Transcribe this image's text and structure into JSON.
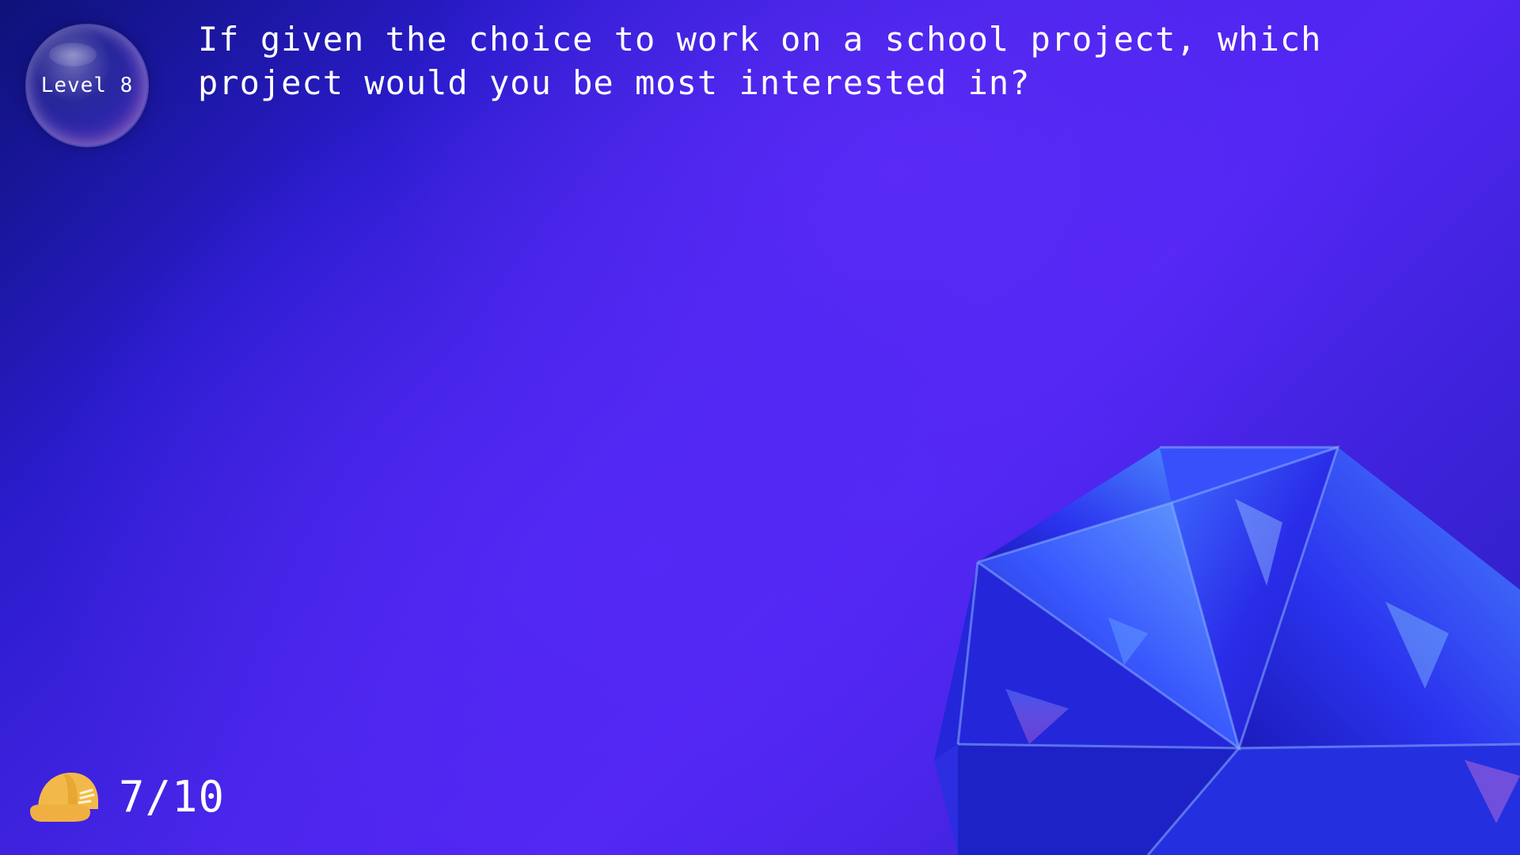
{
  "level": {
    "label": "Level 8"
  },
  "question": {
    "text": "If given the choice to work on a school project, which project would you be most interested in?"
  },
  "progress": {
    "icon": "hard-hat-icon",
    "current": 7,
    "total": 10,
    "text": "7/10"
  },
  "colors": {
    "background_primary": "#5326f4",
    "background_dark": "#0e1278",
    "crystal": "#2f3cff",
    "helmet": "#f2b94a"
  }
}
